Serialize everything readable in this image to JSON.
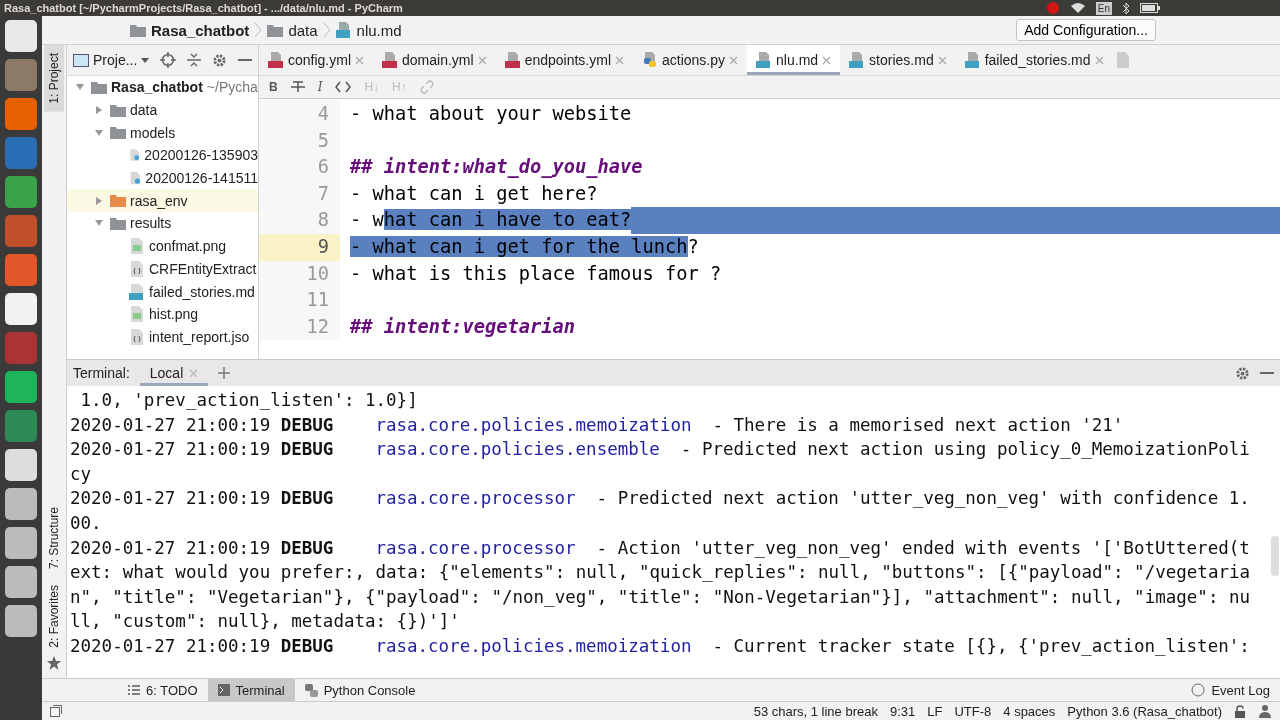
{
  "window": {
    "title": "Rasa_chatbot [~/PycharmProjects/Rasa_chatbot] - .../data/nlu.md - PyCharm",
    "tray_language": "En"
  },
  "breadcrumbs": [
    {
      "label": "Rasa_chatbot",
      "kind": "project"
    },
    {
      "label": "data",
      "kind": "folder"
    },
    {
      "label": "nlu.md",
      "kind": "md"
    }
  ],
  "run_config": {
    "label": "Add Configuration..."
  },
  "side_tools": {
    "top": "1: Project",
    "bottom": [
      "7: Structure",
      "2: Favorites"
    ]
  },
  "project": {
    "title": "Proje...",
    "tree": [
      {
        "label": "Rasa_chatbot",
        "hint": "~/Pycha",
        "kind": "folder",
        "expanded": true,
        "selected": false,
        "children": [
          {
            "label": "data",
            "kind": "folder",
            "expanded": false,
            "selected": false
          },
          {
            "label": "models",
            "kind": "folder",
            "expanded": true,
            "selected": false,
            "children": [
              {
                "label": "20200126-135903",
                "kind": "archive",
                "selected": false
              },
              {
                "label": "20200126-141511",
                "kind": "archive",
                "selected": false
              }
            ]
          },
          {
            "label": "rasa_env",
            "kind": "excluded",
            "expanded": false,
            "selected": true
          },
          {
            "label": "results",
            "kind": "folder",
            "expanded": true,
            "selected": false,
            "children": [
              {
                "label": "confmat.png",
                "kind": "image",
                "selected": false
              },
              {
                "label": "CRFEntityExtract",
                "kind": "json",
                "selected": false
              },
              {
                "label": "failed_stories.md",
                "kind": "md",
                "selected": false
              },
              {
                "label": "hist.png",
                "kind": "image",
                "selected": false
              },
              {
                "label": "intent_report.jso",
                "kind": "json",
                "selected": false
              }
            ]
          }
        ]
      }
    ]
  },
  "editor": {
    "tabs": [
      {
        "label": "config.yml",
        "kind": "yml",
        "selected": false
      },
      {
        "label": "domain.yml",
        "kind": "yml",
        "selected": false
      },
      {
        "label": "endpoints.yml",
        "kind": "yml",
        "selected": false
      },
      {
        "label": "actions.py",
        "kind": "py",
        "selected": false
      },
      {
        "label": "nlu.md",
        "kind": "md",
        "selected": true
      },
      {
        "label": "stories.md",
        "kind": "md",
        "selected": false
      },
      {
        "label": "failed_stories.md",
        "kind": "md",
        "selected": false
      }
    ],
    "toolbar": [
      {
        "kind": "text",
        "label": "B"
      },
      {
        "kind": "strike"
      },
      {
        "kind": "italic",
        "label": "I"
      },
      {
        "kind": "code"
      },
      {
        "kind": "text",
        "label": "H↓"
      },
      {
        "kind": "text",
        "label": "H↑"
      },
      {
        "kind": "link"
      }
    ],
    "lines": [
      {
        "number": "4",
        "kind": "text",
        "current": false,
        "segments": [
          {
            "text": "- what about your website",
            "selected": false
          }
        ]
      },
      {
        "number": "5",
        "current": false
      },
      {
        "number": "6",
        "kind": "heading",
        "current": false,
        "segments": [
          {
            "text": "## intent:what_do_you_have",
            "selected": false
          }
        ]
      },
      {
        "number": "7",
        "kind": "text",
        "current": false,
        "segments": [
          {
            "text": "- what can i get here?",
            "selected": false
          }
        ]
      },
      {
        "number": "8",
        "kind": "text",
        "current": false,
        "selection_to_end": true,
        "segments": [
          {
            "text": "- w",
            "selected": false
          },
          {
            "text": "hat can i have to eat?",
            "selected": true
          }
        ]
      },
      {
        "number": "9",
        "kind": "text",
        "current": true,
        "segments": [
          {
            "text": "- what can i get for the lunch",
            "selected": true
          },
          {
            "text": "?",
            "selected": false
          }
        ]
      },
      {
        "number": "10",
        "kind": "text",
        "current": false,
        "segments": [
          {
            "text": "- what is this place famous for ?",
            "selected": false
          }
        ]
      },
      {
        "number": "11",
        "current": false
      },
      {
        "number": "12",
        "kind": "heading",
        "current": false,
        "segments": [
          {
            "text": "## intent:vegetarian",
            "selected": false
          }
        ]
      }
    ]
  },
  "terminal": {
    "label": "Terminal:",
    "sessions": [
      {
        "label": "Local",
        "selected": true
      }
    ],
    "lines": [
      {
        "kind": "wrap",
        "text": " 1.0, 'prev_action_listen': 1.0}]"
      },
      {
        "kind": "log",
        "time": "2020-01-27 21:00:19",
        "level": "DEBUG",
        "logger": "rasa.core.policies.memoization",
        "message": "- There is a memorised next action '21'"
      },
      {
        "kind": "log",
        "time": "2020-01-27 21:00:19",
        "level": "DEBUG",
        "logger": "rasa.core.policies.ensemble",
        "message": "- Predicted next action using policy_0_MemoizationPoli"
      },
      {
        "kind": "wrap",
        "text": "cy"
      },
      {
        "kind": "log",
        "time": "2020-01-27 21:00:19",
        "level": "DEBUG",
        "logger": "rasa.core.processor",
        "message": "- Predicted next action 'utter_veg_non_veg' with confidence 1."
      },
      {
        "kind": "wrap",
        "text": "00."
      },
      {
        "kind": "log",
        "time": "2020-01-27 21:00:19",
        "level": "DEBUG",
        "logger": "rasa.core.processor",
        "message": "- Action 'utter_veg_non_veg' ended with events '['BotUttered(t"
      },
      {
        "kind": "wrap",
        "text": "ext: what would you prefer:, data: {\"elements\": null, \"quick_replies\": null, \"buttons\": [{\"payload\": \"/vegetaria"
      },
      {
        "kind": "wrap",
        "text": "n\", \"title\": \"Vegetarian\"}, {\"payload\": \"/non_veg\", \"title\": \"Non-Vegetarian\"}], \"attachment\": null, \"image\": nu"
      },
      {
        "kind": "wrap",
        "text": "ll, \"custom\": null}, metadata: {})']'"
      },
      {
        "kind": "log",
        "time": "2020-01-27 21:00:19",
        "level": "DEBUG",
        "logger": "rasa.core.policies.memoization",
        "message": "- Current tracker state [{}, {'prev_action_listen':"
      }
    ]
  },
  "tool_tabs": [
    {
      "label": "6: TODO",
      "kind": "list",
      "selected": false
    },
    {
      "label": "Terminal",
      "kind": "terminal",
      "selected": true
    },
    {
      "label": "Python Console",
      "kind": "python",
      "selected": false
    }
  ],
  "event_log": "Event Log",
  "status_bar": [
    "53 chars, 1 line break",
    "9:31",
    "LF",
    "UTF-8",
    "4 spaces",
    "Python 3.6 (Rasa_chatbot)"
  ]
}
